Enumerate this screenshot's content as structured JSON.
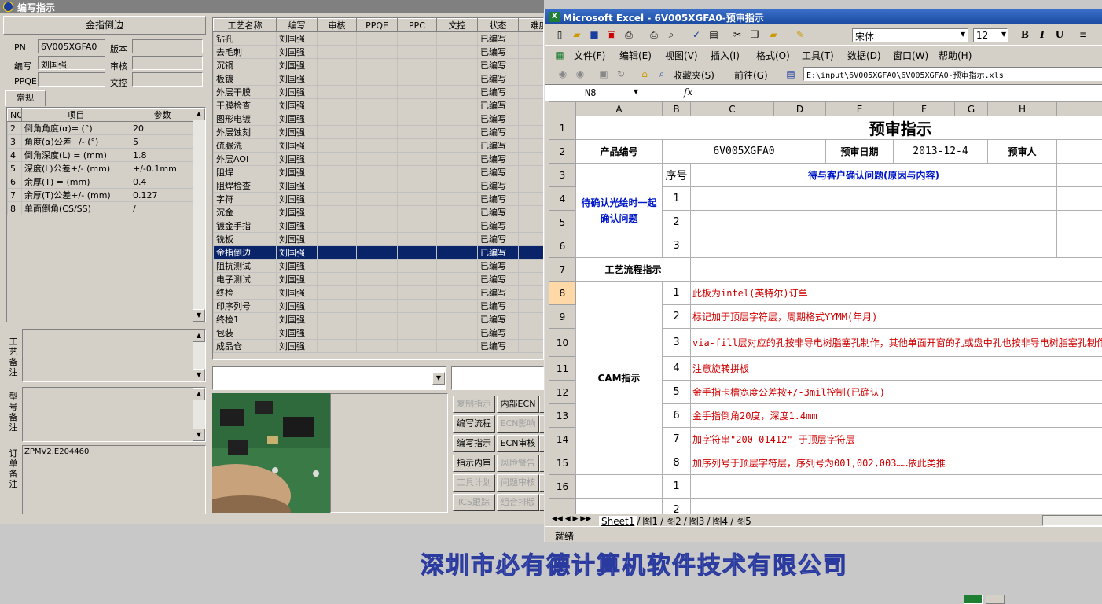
{
  "app": {
    "title": "编写指示"
  },
  "left_panel": {
    "header": "金指倒边",
    "pn_label": "PN",
    "pn_value": "6V005XGFA0",
    "version_label": "版本",
    "version_value": "",
    "writer_label": "编写",
    "writer_value": "刘国强",
    "review_label": "审核",
    "review_value": "",
    "ppqe_label": "PPQE",
    "ppqe_value": "",
    "wenkong_label": "文控",
    "wenkong_value": "",
    "tab_general": "常规"
  },
  "params": {
    "headers": [
      "NO",
      "项目",
      "参数"
    ],
    "rows": [
      {
        "no": "2",
        "item": "倒角角度(α)=  (°)",
        "val": "20"
      },
      {
        "no": "3",
        "item": "角度(α)公差+/-  (°)",
        "val": "5"
      },
      {
        "no": "4",
        "item": "倒角深度(L) =  (mm)",
        "val": "1.8"
      },
      {
        "no": "5",
        "item": "深度(L)公差+/-  (mm)",
        "val": "+/-0.1mm"
      },
      {
        "no": "6",
        "item": "余厚(T) =  (mm)",
        "val": "0.4"
      },
      {
        "no": "7",
        "item": "余厚(T)公差+/-  (mm)",
        "val": "0.127"
      },
      {
        "no": "8",
        "item": "单面倒角(CS/SS)",
        "val": "/"
      }
    ]
  },
  "notes": {
    "process_label": "工艺备注",
    "model_label": "型号备注",
    "order_label": "订单备注",
    "order_text": "ZPMV2.E204460"
  },
  "process": {
    "headers": [
      "工艺名称",
      "编写",
      "审核",
      "PPQE",
      "PPC",
      "文控",
      "状态",
      "难度"
    ],
    "rows": [
      [
        "钻孔",
        "刘国强",
        "已编写"
      ],
      [
        "去毛刺",
        "刘国强",
        "已编写"
      ],
      [
        "沉铜",
        "刘国强",
        "已编写"
      ],
      [
        "板镀",
        "刘国强",
        "已编写"
      ],
      [
        "外层干膜",
        "刘国强",
        "已编写"
      ],
      [
        "干膜检查",
        "刘国强",
        "已编写"
      ],
      [
        "图形电镀",
        "刘国强",
        "已编写"
      ],
      [
        "外层蚀刻",
        "刘国强",
        "已编写"
      ],
      [
        "硫脲洗",
        "刘国强",
        "已编写"
      ],
      [
        "外层AOI",
        "刘国强",
        "已编写"
      ],
      [
        "阻焊",
        "刘国强",
        "已编写"
      ],
      [
        "阻焊检查",
        "刘国强",
        "已编写"
      ],
      [
        "字符",
        "刘国强",
        "已编写"
      ],
      [
        "沉金",
        "刘国强",
        "已编写"
      ],
      [
        "镀金手指",
        "刘国强",
        "已编写"
      ],
      [
        "铣板",
        "刘国强",
        "已编写"
      ],
      [
        "金指倒边",
        "刘国强",
        "已编写"
      ],
      [
        "阻抗测试",
        "刘国强",
        "已编写"
      ],
      [
        "电子测试",
        "刘国强",
        "已编写"
      ],
      [
        "终检",
        "刘国强",
        "已编写"
      ],
      [
        "印序列号",
        "刘国强",
        "已编写"
      ],
      [
        "终检1",
        "刘国强",
        "已编写"
      ],
      [
        "包装",
        "刘国强",
        "已编写"
      ],
      [
        "成品仓",
        "刘国强",
        "已编写"
      ]
    ],
    "selected_index": 16
  },
  "buttons": [
    {
      "label": "复制指示",
      "disabled": true
    },
    {
      "label": "内部ECN",
      "disabled": false
    },
    {
      "label": "编写流程",
      "disabled": false
    },
    {
      "label": "ECN影响",
      "disabled": true
    },
    {
      "label": "编写指示",
      "disabled": false
    },
    {
      "label": "ECN审核",
      "disabled": false
    },
    {
      "label": "指示内审",
      "disabled": false
    },
    {
      "label": "风险警告",
      "disabled": true
    },
    {
      "label": "工具计划",
      "disabled": true
    },
    {
      "label": "问题审核",
      "disabled": true
    },
    {
      "label": "ICS跟踪",
      "disabled": true
    },
    {
      "label": "组合排版",
      "disabled": true
    }
  ],
  "excel": {
    "title": "Microsoft Excel - 6V005XGFA0-预审指示",
    "font_name": "宋体",
    "font_size": "12",
    "menus": [
      "文件(F)",
      "编辑(E)",
      "视图(V)",
      "插入(I)",
      "格式(O)",
      "工具(T)",
      "数据(D)",
      "窗口(W)",
      "帮助(H)"
    ],
    "favorites": "收藏夹(S)",
    "goto": "前往(G)",
    "path": "E:\\input\\6V005XGFA0\\6V005XGFA0-预审指示.xls",
    "cell_ref": "N8",
    "fx": "fx",
    "col_headers": [
      "A",
      "B",
      "C",
      "D",
      "E",
      "F",
      "G",
      "H"
    ],
    "row_headers": [
      "1",
      "2",
      "3",
      "4",
      "5",
      "6",
      "7",
      "8",
      "9",
      "10",
      "11",
      "12",
      "13",
      "14",
      "15",
      "16"
    ],
    "sheet_title": "预审指示",
    "product_label": "产品编号",
    "product_value": "6V005XGFA0",
    "date_label": "预审日期",
    "date_value": "2013-12-4",
    "reviewer_label": "预审人",
    "seq_label": "序号",
    "confirm_title": "待与客户确认问题(原因与内容)",
    "pending_label": "待确认光绘时一起确认问题",
    "pending_nums": [
      "1",
      "2",
      "3"
    ],
    "flow_label": "工艺流程指示",
    "cam_label": "CAM指示",
    "cam_items": [
      {
        "n": "1",
        "t": "此板为intel(英特尔)订单"
      },
      {
        "n": "2",
        "t": "标记加于顶层字符层，周期格式YYMM(年月)"
      },
      {
        "n": "3",
        "t": "via-fill层对应的孔按非导电树脂塞孔制作，其他单面开窗的孔或盘中孔也按非导电树脂塞孔制作"
      },
      {
        "n": "4",
        "t": "注意旋转拼板"
      },
      {
        "n": "5",
        "t": "金手指卡槽宽度公差按+/-3mil控制(已确认)"
      },
      {
        "n": "6",
        "t": "金手指倒角20度，深度1.4mm"
      },
      {
        "n": "7",
        "t": "加字符串\"200-01412\" 于顶层字符层"
      },
      {
        "n": "8",
        "t": "加序列号于顶层字符层，序列号为001,002,003……依此类推"
      }
    ],
    "row16_num": "1",
    "row17_num": "2",
    "sheets": [
      "Sheet1",
      "图1",
      "图2",
      "图3",
      "图4",
      "图5"
    ],
    "status": "就绪"
  },
  "footer": {
    "company": "深圳市必有德计算机软件技术有限公司"
  }
}
